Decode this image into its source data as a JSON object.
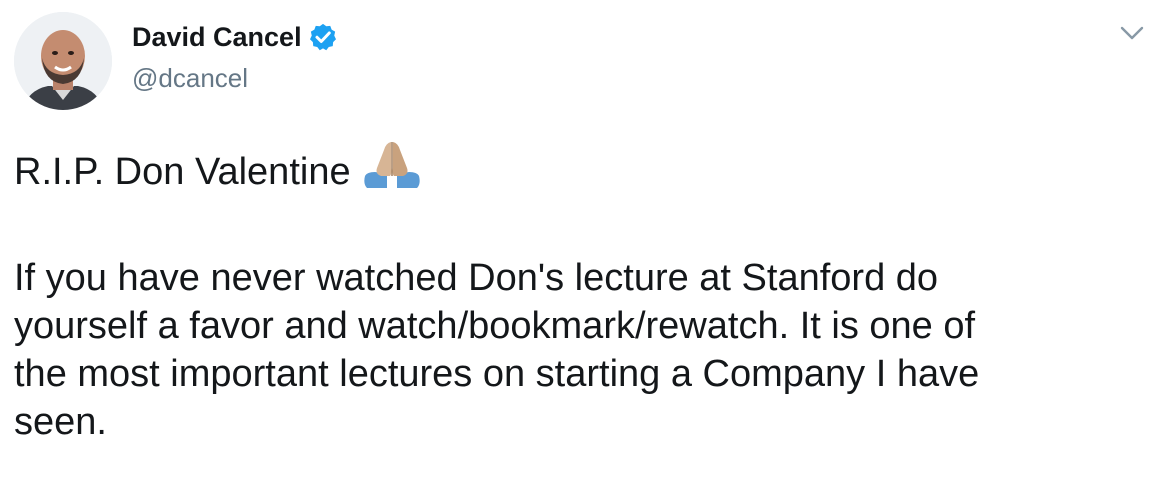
{
  "author": {
    "name": "David Cancel",
    "handle": "@dcancel",
    "verified": true,
    "avatar_icon": "profile-photo-icon"
  },
  "menu": {
    "icon": "chevron-down-icon"
  },
  "tweet": {
    "line1": "R.I.P. Don Valentine",
    "emoji": "folded-hands-icon",
    "line2": "If you have never watched Don's lecture at Stanford do",
    "line3": "yourself a favor and watch/bookmark/rewatch. It is one of",
    "line4": "the most important lectures on starting a Company I have",
    "line5": "seen."
  },
  "colors": {
    "text": "#14171a",
    "secondary": "#657786",
    "verified": "#1da1f2"
  }
}
